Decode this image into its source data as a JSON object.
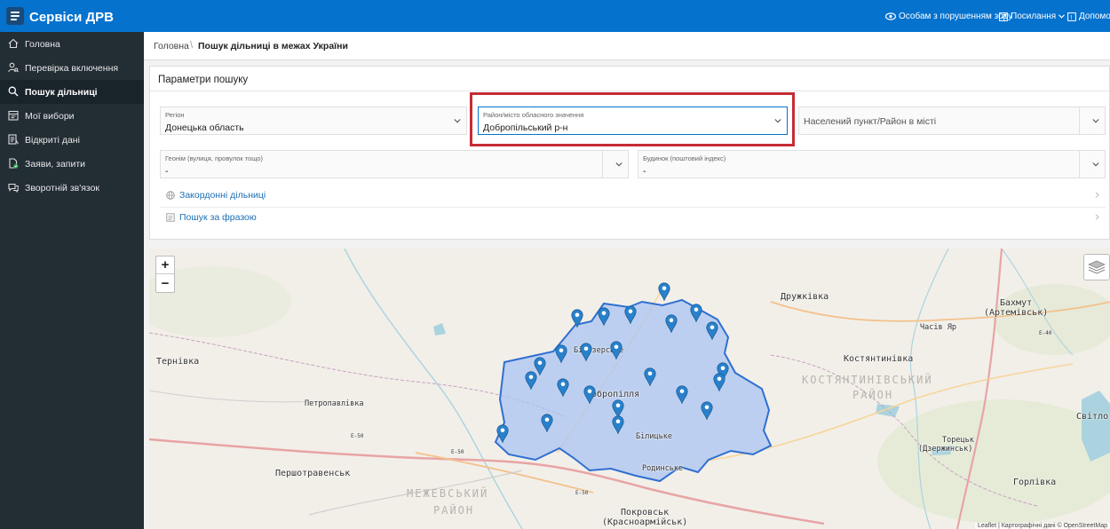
{
  "header": {
    "app_title": "Сервіси ДРВ",
    "links": [
      {
        "label": "Особам з порушенням зору",
        "icon": "eye-icon"
      },
      {
        "label": "Посилання",
        "icon": "external-link-icon"
      },
      {
        "label": "Допомога",
        "icon": "help-icon"
      }
    ]
  },
  "sidebar": {
    "items": [
      {
        "label": "Головна",
        "icon": "home-icon",
        "active": false
      },
      {
        "label": "Перевірка включення",
        "icon": "user-search-icon",
        "active": false
      },
      {
        "label": "Пошук дільниці",
        "icon": "search-icon",
        "active": true
      },
      {
        "label": "Мої вибори",
        "icon": "calendar-icon",
        "active": false
      },
      {
        "label": "Відкриті дані",
        "icon": "database-icon",
        "active": false
      },
      {
        "label": "Заяви, запити",
        "icon": "document-icon",
        "active": false
      },
      {
        "label": "Зворотній зв'язок",
        "icon": "chat-icon",
        "active": false
      }
    ]
  },
  "breadcrumb": {
    "home": "Головна",
    "separator": "\\",
    "current": "Пошук дільниці в межах України"
  },
  "search_panel": {
    "title": "Параметри пошуку",
    "region": {
      "label": "Регіон",
      "value": "Донецька область"
    },
    "district": {
      "label": "Район/місто обласного значення",
      "value": "Добропільський р-н"
    },
    "settlement": {
      "placeholder": "Населений пункт/Район в місті"
    },
    "street": {
      "label": "Геонім (вулиця, провулок тощо)",
      "value": "-"
    },
    "building": {
      "label": "Будинок (поштовий індекс)",
      "value": "-"
    },
    "links": [
      {
        "label": "Закордонні дільниці",
        "icon": "globe-icon"
      },
      {
        "label": "Пошук за фразою",
        "icon": "list-icon"
      }
    ]
  },
  "map": {
    "zoom_in": "+",
    "zoom_out": "−",
    "labels": {
      "druzhkivka": "Дружківка",
      "bakhmut": "Бахмут",
      "bakhmut_old": "(Артемівськ)",
      "chasiv_yar": "Часів Яр",
      "ternivka": "Тернівка",
      "bilozerske": "Білозерське",
      "dobropillia": "Добропілля",
      "kostiantynivka": "Костянтинівка",
      "kostiantynivskyi": "КОСТЯНТИНІВСЬКИЙ",
      "raion": "РАЙОН",
      "petropavlivka": "Петропавлівка",
      "svitlodarsk": "Світло",
      "bilytske": "Білицьке",
      "toretsk": "Торецьк",
      "toretsk_old": "(Дзержинськ)",
      "rodynske": "Родинське",
      "pershotravensk": "Першотравенськ",
      "mezhivskyi": "МЕЖЕВСЬКИЙ",
      "raion2": "РАЙОН",
      "horlivka": "Горлівка",
      "pokrovsk": "Покровськ",
      "pokrovsk_old": "(Красноармійськ)",
      "road_e50a": "E-50",
      "road_e50b": "E-50",
      "road_e50c": "E-50",
      "road_e40": "E-40"
    },
    "attribution": "Leaflet | Картографічні дані © OpenStreetMap"
  },
  "colors": {
    "header": "#0572ce",
    "sidebar": "#222d34",
    "highlight": "#c62c35",
    "district_fill": "#a9c4f2",
    "district_stroke": "#2f6fd1",
    "marker": "#2a81cb"
  }
}
